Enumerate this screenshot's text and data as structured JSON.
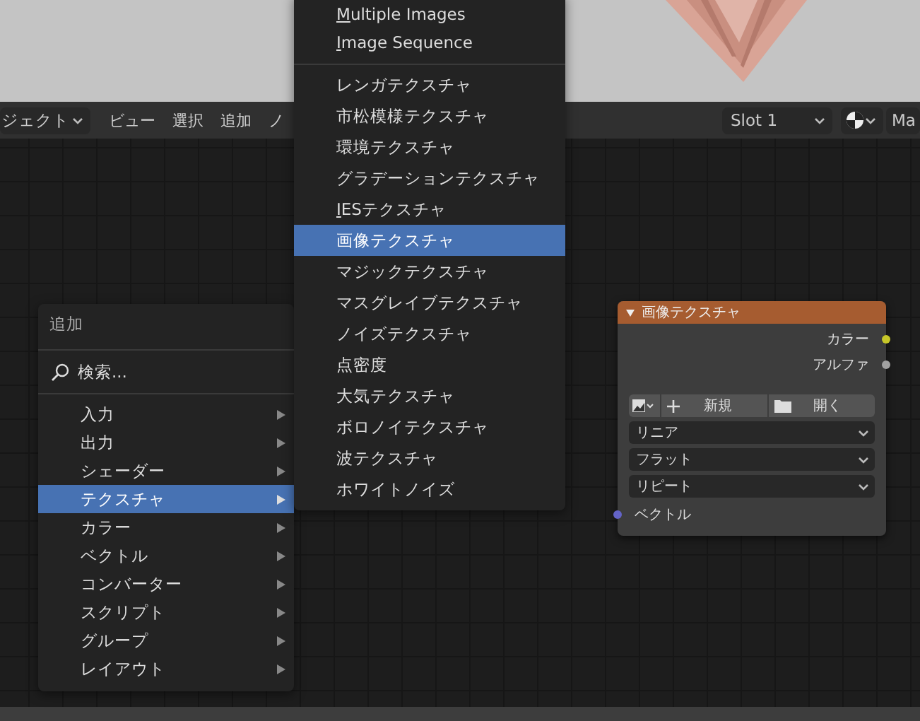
{
  "header": {
    "mode_dropdown": "ジェクト",
    "menus": [
      "ビュー",
      "選択",
      "追加",
      "ノ"
    ],
    "slot_dropdown": "Slot 1",
    "material_field": "Ma"
  },
  "add_menu": {
    "title": "追加",
    "search": "検索...",
    "items": [
      {
        "label": "入力",
        "selected": false
      },
      {
        "label": "出力",
        "selected": false
      },
      {
        "label": "シェーダー",
        "selected": false
      },
      {
        "label": "テクスチャ",
        "selected": true
      },
      {
        "label": "カラー",
        "selected": false
      },
      {
        "label": "ベクトル",
        "selected": false
      },
      {
        "label": "コンバーター",
        "selected": false
      },
      {
        "label": "スクリプト",
        "selected": false
      },
      {
        "label": "グループ",
        "selected": false
      },
      {
        "label": "レイアウト",
        "selected": false
      }
    ]
  },
  "texture_menu": {
    "top_items": [
      {
        "label": "Multiple Images",
        "mnemonic": true
      },
      {
        "label": "Image Sequence",
        "mnemonic": true
      }
    ],
    "items": [
      {
        "label": "レンガテクスチャ",
        "selected": false,
        "mnemonic": false
      },
      {
        "label": "市松模様テクスチャ",
        "selected": false,
        "mnemonic": false
      },
      {
        "label": "環境テクスチャ",
        "selected": false,
        "mnemonic": false
      },
      {
        "label": "グラデーションテクスチャ",
        "selected": false,
        "mnemonic": false
      },
      {
        "label": "IESテクスチャ",
        "selected": false,
        "mnemonic": true
      },
      {
        "label": "画像テクスチャ",
        "selected": true,
        "mnemonic": false
      },
      {
        "label": "マジックテクスチャ",
        "selected": false,
        "mnemonic": false
      },
      {
        "label": "マスグレイブテクスチャ",
        "selected": false,
        "mnemonic": false
      },
      {
        "label": "ノイズテクスチャ",
        "selected": false,
        "mnemonic": false
      },
      {
        "label": "点密度",
        "selected": false,
        "mnemonic": false
      },
      {
        "label": "大気テクスチャ",
        "selected": false,
        "mnemonic": false
      },
      {
        "label": "ボロノイテクスチャ",
        "selected": false,
        "mnemonic": false
      },
      {
        "label": "波テクスチャ",
        "selected": false,
        "mnemonic": false
      },
      {
        "label": "ホワイトノイズ",
        "selected": false,
        "mnemonic": false
      }
    ]
  },
  "node": {
    "title": "画像テクスチャ",
    "outputs": [
      {
        "label": "カラー",
        "color": "#c7c729"
      },
      {
        "label": "アルファ",
        "color": "#a1a1a1"
      }
    ],
    "new_button": "新規",
    "open_button": "開く",
    "dropdowns": [
      "リニア",
      "フラット",
      "リピート"
    ],
    "inputs": [
      {
        "label": "ベクトル",
        "color": "#6363c7"
      }
    ]
  }
}
